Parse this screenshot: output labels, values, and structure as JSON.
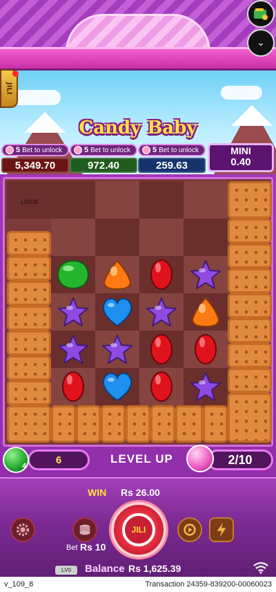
{
  "game": {
    "title": "Candy Baby",
    "provider_tab": "JILI"
  },
  "jackpots": [
    {
      "unlock_num": "5",
      "unlock_text": "Bet to unlock",
      "value": "5,349.70",
      "color": "#6a1414"
    },
    {
      "unlock_num": "5",
      "unlock_text": "Bet to unlock",
      "value": "972.40",
      "color": "#1f5c1d"
    },
    {
      "unlock_num": "5",
      "unlock_text": "Bet to unlock",
      "value": "259.63",
      "color": "#15346e"
    }
  ],
  "mini": {
    "label": "MINI",
    "value": "0.40"
  },
  "board": {
    "lock_label": "LOCK",
    "candies": [
      [
        "green-diamond",
        "orange-drop",
        "red-oval",
        "purple-star"
      ],
      [
        "purple-star",
        "blue-heart",
        "purple-star",
        "orange-drop"
      ],
      [
        "purple-star",
        "purple-star",
        "red-oval",
        "red-oval"
      ],
      [
        "red-oval",
        "blue-heart",
        "red-oval",
        "purple-star"
      ]
    ]
  },
  "progress": {
    "gem_count": "4",
    "collected": "6",
    "level_label": "LEVEL UP",
    "level": "2/10"
  },
  "win": {
    "label": "WIN",
    "value": "Rs 26.00"
  },
  "bet": {
    "label": "Bet",
    "value": "Rs 10"
  },
  "spin_label": "JILI",
  "balance": {
    "level_badge": "LV0",
    "label": "Balance",
    "value": "Rs 1,625.39"
  },
  "footer": {
    "version": "v_109_8",
    "transaction": "Transaction 24359-839200-00060023"
  },
  "colors": {
    "candy_green": "#26b52f",
    "candy_orange": "#ff7a12",
    "candy_red": "#e0131c",
    "candy_purple": "#8f4be0",
    "candy_blue": "#1f8ff0"
  }
}
